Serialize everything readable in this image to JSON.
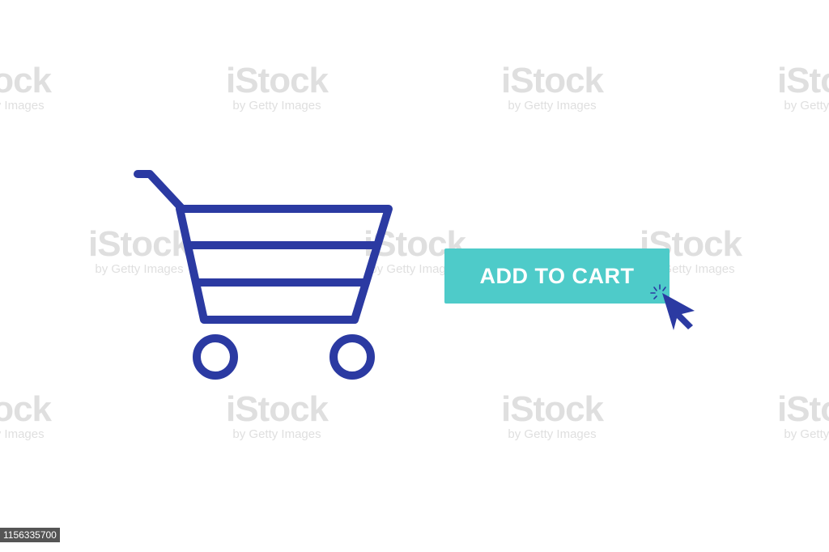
{
  "watermark": {
    "brand": "iStock",
    "sub": "by Getty Images"
  },
  "button": {
    "label": "ADD TO CART"
  },
  "image_id": "1156335700",
  "colors": {
    "cart_stroke": "#2b3aa2",
    "button_bg": "#4ecbc9",
    "pointer": "#2b3aa2",
    "background": "#ffffff"
  },
  "icons": {
    "cart": "shopping-cart-icon",
    "pointer": "mouse-pointer-icon"
  }
}
